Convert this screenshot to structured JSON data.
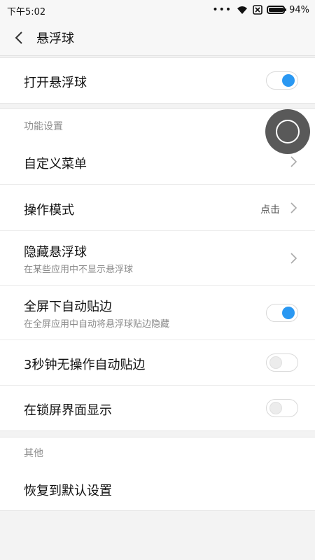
{
  "status_bar": {
    "time": "下午5:02",
    "dots": "•••",
    "battery": "94%"
  },
  "header": {
    "title": "悬浮球"
  },
  "main_toggle": {
    "label": "打开悬浮球",
    "state": "on"
  },
  "features": {
    "section_title": "功能设置",
    "items": [
      {
        "label": "自定义菜单"
      },
      {
        "label": "操作模式",
        "value": "点击"
      },
      {
        "label": "隐藏悬浮球",
        "subtitle": "在某些应用中不显示悬浮球"
      },
      {
        "label": "全屏下自动贴边",
        "subtitle": "在全屏应用中自动将悬浮球贴边隐藏",
        "toggle": "on"
      },
      {
        "label": "3秒钟无操作自动贴边",
        "toggle": "off"
      },
      {
        "label": "在锁屏界面显示",
        "toggle": "off"
      }
    ]
  },
  "other": {
    "section_title": "其他",
    "items": [
      {
        "label": "恢复到默认设置"
      }
    ]
  },
  "colors": {
    "accent": "#2a98f2",
    "background": "#f3f3f3"
  },
  "icons": {
    "back": "chevron-left-icon",
    "row_arrow": "chevron-right-icon",
    "wifi": "wifi-icon",
    "sim": "no-sim-icon",
    "battery": "battery-icon"
  }
}
